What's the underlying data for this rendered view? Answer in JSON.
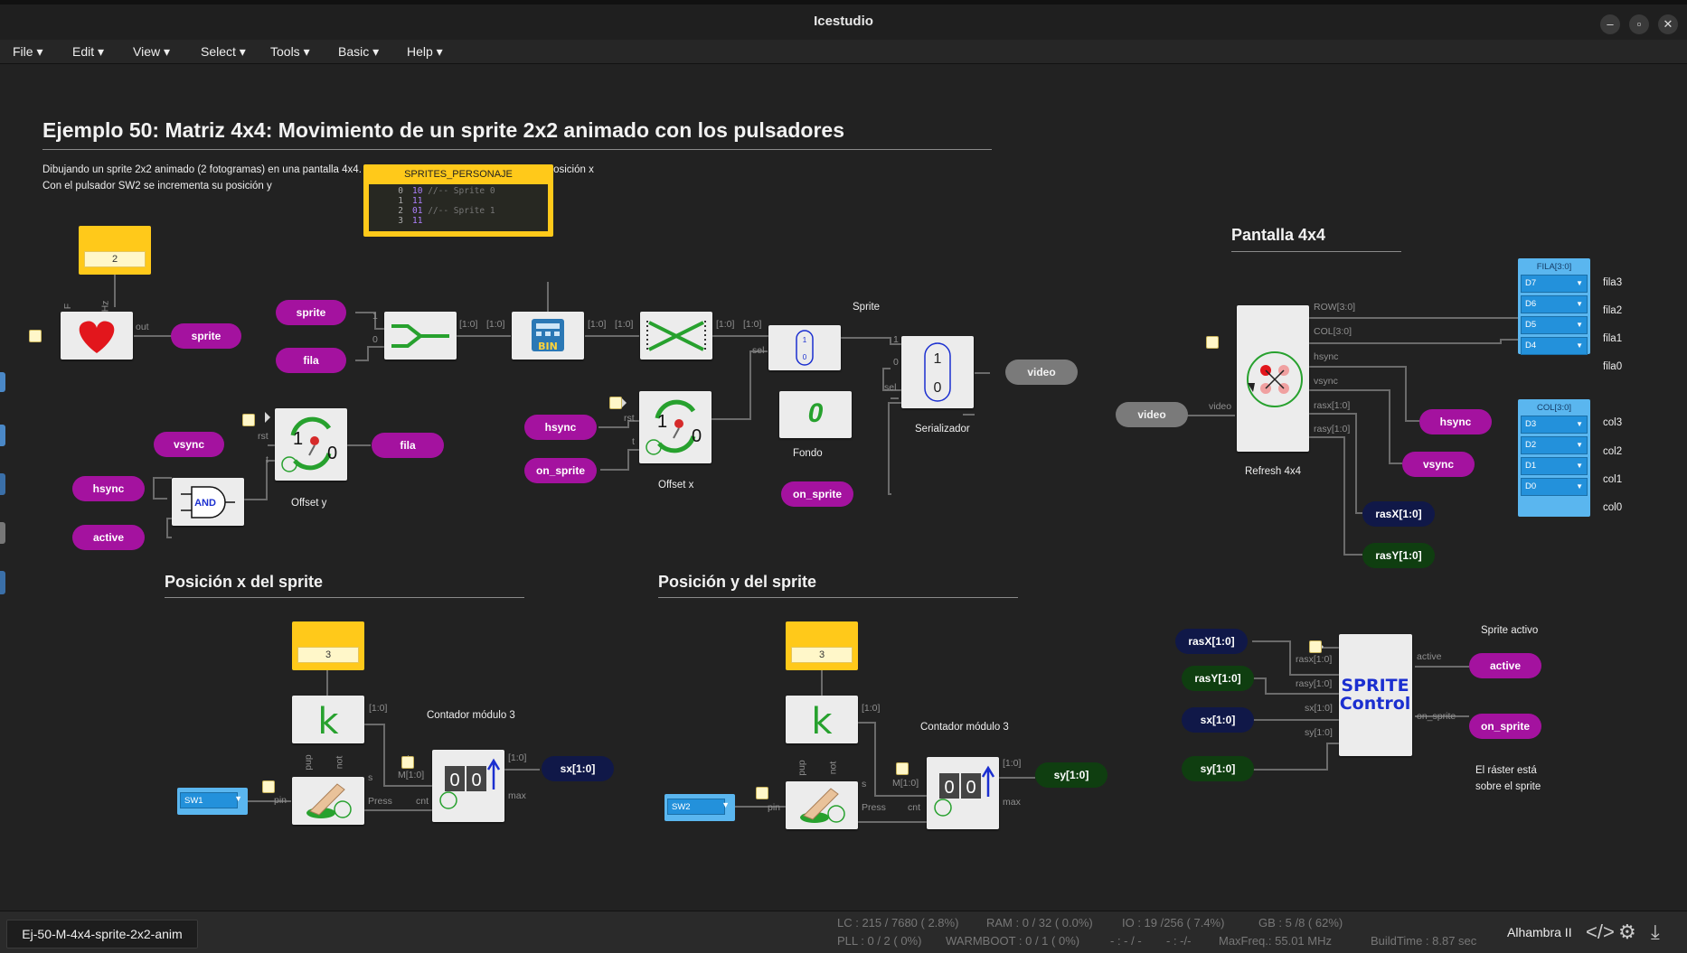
{
  "window": {
    "title": "Icestudio"
  },
  "menu": [
    "File",
    "Edit",
    "View",
    "Select",
    "Tools",
    "Basic",
    "Help"
  ],
  "header": {
    "title": "Ejemplo 50: Matriz 4x4: Movimiento de un sprite 2x2 animado con los pulsadores",
    "desc1": "Dibujando un sprite 2x2 animado (2 fotogramas) en una pantalla 4x4. Con el pulsador SW1 se incrementa su posición x",
    "desc2": "Con el pulsador SW2 se incrementa su posición y"
  },
  "sections": {
    "pantalla": "Pantalla 4x4",
    "posx": "Posición x del sprite",
    "posy": "Posición y del sprite"
  },
  "consts": {
    "freq": "2",
    "kx": "3",
    "ky": "3"
  },
  "code_block": {
    "title": "SPRITES_PERSONAJE",
    "lines": [
      {
        "n": "0",
        "v": "10",
        "c": "//-- Sprite 0"
      },
      {
        "n": "1",
        "v": "11",
        "c": ""
      },
      {
        "n": "2",
        "v": "01",
        "c": "//-- Sprite 1"
      },
      {
        "n": "3",
        "v": "11",
        "c": ""
      }
    ]
  },
  "pills": {
    "sprite_out": "sprite",
    "sprite_in": "sprite",
    "fila_in": "fila",
    "vsync1": "vsync",
    "hsync1": "hsync",
    "active1": "active",
    "fila_out": "fila",
    "hsync2": "hsync",
    "on_sprite1": "on_sprite",
    "on_sprite2": "on_sprite",
    "video_out": "video",
    "video_in": "video",
    "hsync3": "hsync",
    "vsync3": "vsync",
    "rasx_out": "rasX[1:0]",
    "rasy_out": "rasY[1:0]",
    "sx_out": "sx[1:0]",
    "sy_out": "sy[1:0]",
    "rasx_in": "rasX[1:0]",
    "rasy_in": "rasY[1:0]",
    "sx_in": "sx[1:0]",
    "sy_in": "sy[1:0]",
    "active_out": "active",
    "on_sprite_out": "on_sprite"
  },
  "labels": {
    "offset_y": "Offset y",
    "offset_x": "Offset x",
    "sprite": "Sprite",
    "fondo": "Fondo",
    "serializador": "Serializador",
    "refresh": "Refresh 4x4",
    "contador1": "Contador módulo 3",
    "contador2": "Contador módulo 3",
    "sprite_activo": "Sprite activo",
    "raster1": "El ráster está",
    "raster2": "sobre el sprite",
    "sprite_control": "SPRITE\nControl"
  },
  "ports": {
    "f": "F",
    "hz": "Hz",
    "out": "out",
    "one": "1",
    "zero": "0",
    "b10": "[1:0]",
    "sel": "sel",
    "rst": "rst",
    "t": "t",
    "row": "ROW[3:0]",
    "col": "COL[3:0]",
    "hsync": "hsync",
    "vsync": "vsync",
    "rasx": "rasx[1:0]",
    "rasy": "rasy[1:0]",
    "video": "video",
    "sx": "sx[1:0]",
    "sy": "sy[1:0]",
    "active": "active",
    "on_sprite": "on_sprite",
    "m10": "M[1:0]",
    "cnt": "cnt",
    "max": "max",
    "pin": "pin",
    "press": "Press",
    "pup": "pup",
    "not": "not",
    "s": "s"
  },
  "switches": {
    "sw1": "SW1",
    "sw2": "SW2"
  },
  "fila_group": {
    "title": "FILA[3:0]",
    "items": [
      "D7",
      "D6",
      "D5",
      "D4"
    ],
    "names": [
      "fila3",
      "fila2",
      "fila1",
      "fila0"
    ]
  },
  "col_group": {
    "title": "COL[3:0]",
    "items": [
      "D3",
      "D2",
      "D1",
      "D0"
    ],
    "names": [
      "col3",
      "col2",
      "col1",
      "col0"
    ]
  },
  "status": {
    "file": "Ej-50-M-4x4-sprite-2x2-anim",
    "lc": "LC : 215 / 7680 ( 2.8%)",
    "ram": "RAM : 0 / 32 ( 0.0%)",
    "io": "IO : 19 /256 ( 7.4%)",
    "gb": "GB : 5 /8 ( 62%)",
    "pll": "PLL : 0 / 2 ( 0%)",
    "warmboot": "WARMBOOT : 0 / 1 ( 0%)",
    "dash1": "- : - / -",
    "dash2": "- : -/-",
    "maxfreq": "MaxFreq.: 55.01 MHz",
    "buildtime": "BuildTime : 8.87 sec",
    "board": "Alhambra II"
  },
  "colors": {
    "magenta": "#a4129f",
    "navy": "#101848",
    "dark_green": "#0f3e10",
    "yellow": "#ffc91a",
    "blue": "#5ab6ef"
  }
}
